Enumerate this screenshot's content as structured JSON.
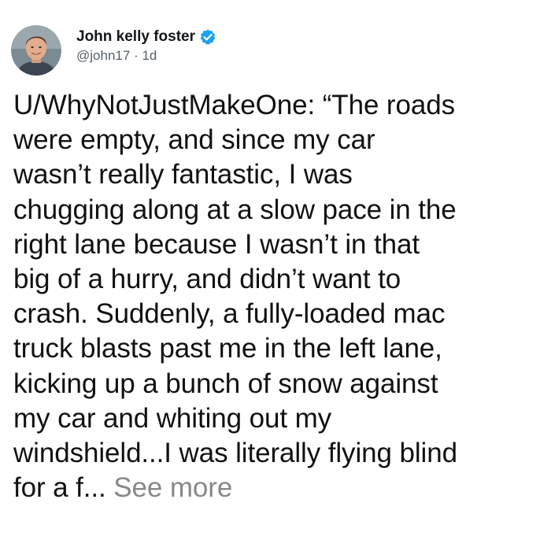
{
  "tweet": {
    "author": {
      "display_name": "John kelly foster",
      "handle": "@john17",
      "separator": "·",
      "age": "1d",
      "verified": true,
      "avatar_icon": "profile-photo-avatar",
      "verified_icon": "verified-badge-icon",
      "verified_color": "#1da1f2"
    },
    "text_lines": [
      "U/WhyNotJustMakeOne: “The roads",
      "were empty, and since my car",
      "wasn’t really fantastic, I was",
      "chugging along at a slow pace in the",
      "right lane because I wasn’t in that",
      "big of a hurry, and didn’t want to",
      "crash. Suddenly, a fully-loaded mac",
      "truck blasts past me in the left lane,",
      "kicking up a bunch of snow against",
      "my car and whiting out my",
      "windshield...I was literally flying blind",
      "for a f..."
    ],
    "see_more_label": "See more"
  }
}
